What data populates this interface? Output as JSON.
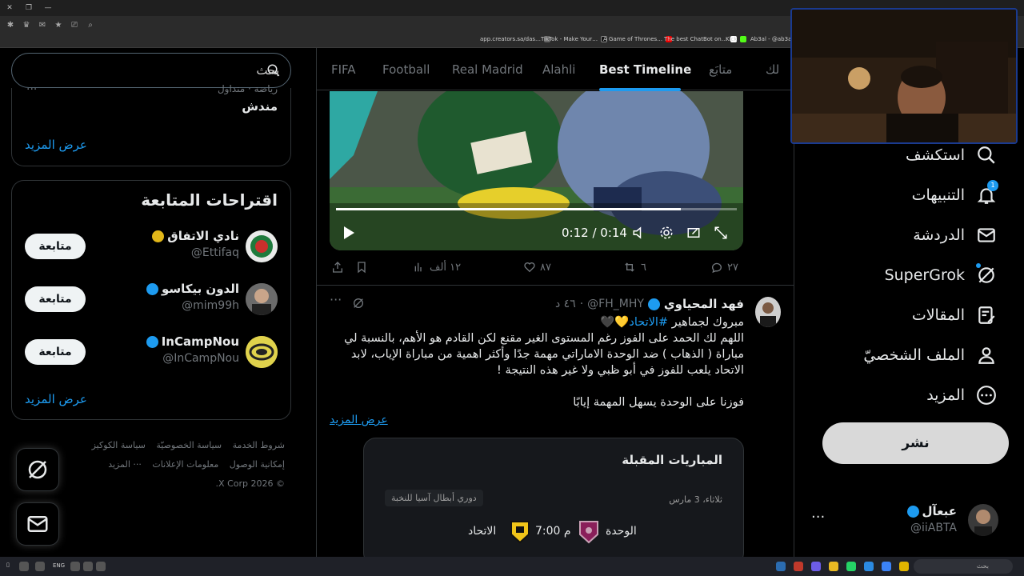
{
  "bookmarks": [
    "app.creators.sa/das…",
    "TikTok - Make Your…",
    "A Game of Thrones…",
    "The best ChatBot on…",
    "Kick",
    "Ab3al - @ab3al (…"
  ],
  "search": {
    "placeholder": "بحث"
  },
  "trend": {
    "meta": "رياضة · متداول",
    "name": "مندش",
    "dots": "···",
    "show_more": "عرض المزيد"
  },
  "who_to_follow": {
    "title": "اقتراحات المتابعة",
    "follow_label": "متابعة",
    "show_more": "عرض المزيد",
    "accounts": [
      {
        "name": "نادي الاتفاق",
        "handle": "@Ettifaq",
        "badge_color": "#e2b719"
      },
      {
        "name": "الدون بيكاسو",
        "handle": "@mim99h",
        "badge_color": "#1d9bf0"
      },
      {
        "name": "InCampNou",
        "handle": "@InCampNou",
        "badge_color": "#1d9bf0"
      }
    ]
  },
  "footer": {
    "links": [
      "شروط الخدمة",
      "سياسة الخصوصيّة",
      "سياسة الكوكيز",
      "إمكانية الوصول",
      "معلومات الإعلانات",
      "··· المزيد"
    ],
    "copyright": "© 2026 X Corp."
  },
  "tabs": [
    "لك",
    "متابَع",
    "Best Timeline",
    "Alahli",
    "Real Madrid",
    "Football",
    "FIFA"
  ],
  "active_tab": "Best Timeline",
  "video": {
    "time": "0:12 / 0:14",
    "progress": 0.86
  },
  "tweet_actions": {
    "replies": "٢٧",
    "retweets": "٦",
    "likes": "٨٧",
    "views": "١٢ ألف"
  },
  "post": {
    "author": "فهد المحياوي",
    "handle": "@FH_MHY",
    "time": "٤٦ د",
    "line1_prefix": "مبروك لجماهير ",
    "hashtag": "#الاتحاد",
    "hearts": "💛🖤",
    "line2": "اللهم لك الحمد على الفوز رغم المستوى الغير مقنع لكن القادم هو الأهم، بالنسبة لي مباراة ( الذهاب ) ضد الوحدة الاماراتي مهمة جدًا وأكثر اهمية من مباراة الإياب، لابد الاتحاد يلعب للفوز في أبو ظبي ولا غير هذه النتيجة !",
    "line3": "فوزنا على الوحدة يسهل المهمة إيابًا",
    "show_more": "عرض المزيد"
  },
  "match_card": {
    "title": "المباريات المقبلة",
    "date": "ثلاثاء، 3 مارس",
    "league": "دوري أبطال آسيا للنخبة",
    "home": "الوحدة",
    "time": "7:00 م",
    "away": "الاتحاد"
  },
  "nav": [
    {
      "label": "استكشف",
      "icon": "search-icon"
    },
    {
      "label": "التنبيهات",
      "icon": "bell-icon",
      "badge": "1"
    },
    {
      "label": "الدردشة",
      "icon": "mail-icon"
    },
    {
      "label": "SuperGrok",
      "icon": "grok-icon"
    },
    {
      "label": "المقالات",
      "icon": "article-icon"
    },
    {
      "label": "الملف الشخصيّ",
      "icon": "person-icon"
    },
    {
      "label": "المزيد",
      "icon": "more-circle-icon"
    }
  ],
  "post_button": "نشر",
  "account": {
    "name": "عبعآل",
    "handle": "@iiABTA",
    "dots": "···"
  },
  "taskbar": {
    "lang": "ENG",
    "search": "بحث"
  },
  "colors": {
    "accent": "#1d9bf0",
    "gold_badge": "#e2b719"
  }
}
